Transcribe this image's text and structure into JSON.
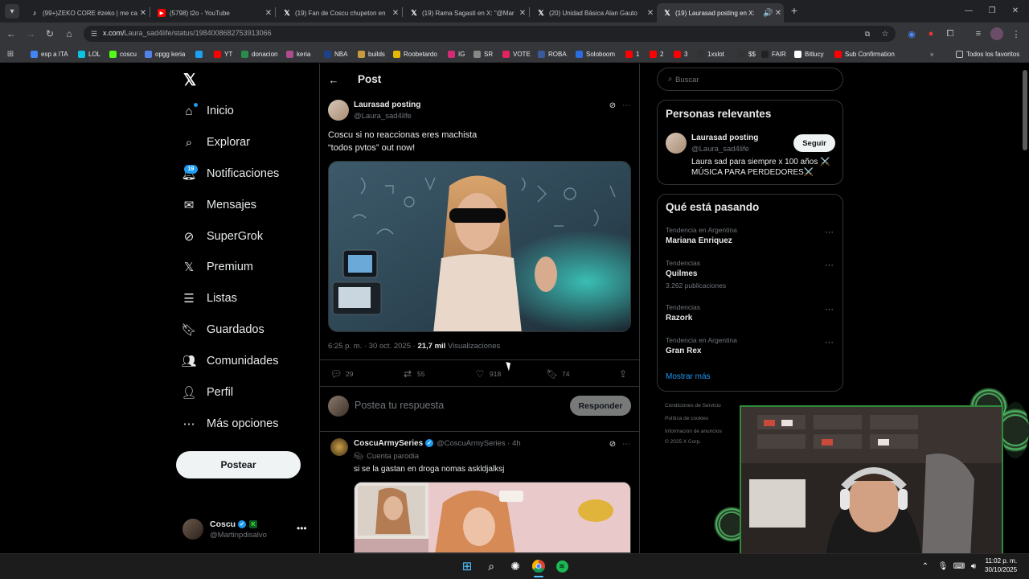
{
  "browser": {
    "tabs": [
      {
        "title": "(99+)ZEKO CORE #zeko | me ca",
        "favicon": "tiktok-icon",
        "active": false
      },
      {
        "title": "(5798) t2o - YouTube",
        "favicon": "youtube-icon",
        "active": false
      },
      {
        "title": "(19) Fan de Coscu chupeton en",
        "favicon": "x-icon",
        "active": false
      },
      {
        "title": "(19) Rama Sagasti en X: \"@Mar",
        "favicon": "x-icon",
        "active": false
      },
      {
        "title": "(20) Unidad Básica Alan Gauto",
        "favicon": "x-icon",
        "active": false
      },
      {
        "title": "(19) Laurasad posting en X:",
        "favicon": "x-icon",
        "active": true
      }
    ],
    "url_host": "x.com/",
    "url_path": "Laura_sad4life/status/1984008682753913066",
    "bookmarks": [
      {
        "label": "esp a ITA",
        "color": "#4285f4"
      },
      {
        "label": "LOL",
        "color": "#0bc4e2"
      },
      {
        "label": "coscu",
        "color": "#53fc18"
      },
      {
        "label": "opgg keria",
        "color": "#5383e8"
      },
      {
        "label": "",
        "color": "#1da1f2"
      },
      {
        "label": "YT",
        "color": "#ff0000"
      },
      {
        "label": "donacion",
        "color": "#2a8c4a"
      },
      {
        "label": "keria",
        "color": "#b04a8f"
      },
      {
        "label": "NBA",
        "color": "#1d428a"
      },
      {
        "label": "builds",
        "color": "#c89b3c"
      },
      {
        "label": "Roobetardo",
        "color": "#e6b800"
      },
      {
        "label": "IG",
        "color": "#d62976"
      },
      {
        "label": "SR",
        "color": "#888888"
      },
      {
        "label": "VOTE",
        "color": "#e0245e"
      },
      {
        "label": "ROBA",
        "color": "#3b5998"
      },
      {
        "label": "Soloboom",
        "color": "#2b6de0"
      },
      {
        "label": "1",
        "color": "#ff0000"
      },
      {
        "label": "2",
        "color": "#ff0000"
      },
      {
        "label": "3",
        "color": "#ff0000"
      },
      {
        "label": "1xslot",
        "color": "#333333"
      },
      {
        "label": "$$",
        "color": "#333333"
      },
      {
        "label": "FAIR",
        "color": "#222222"
      },
      {
        "label": "Bitlucy",
        "color": "#ffffff"
      },
      {
        "label": "Sub Confirmation",
        "color": "#ff0000"
      }
    ],
    "all_favorites": "Todos los favoritos"
  },
  "nav": {
    "items": [
      {
        "label": "Inicio",
        "icon": "home-icon"
      },
      {
        "label": "Explorar",
        "icon": "search-icon"
      },
      {
        "label": "Notificaciones",
        "icon": "bell-icon"
      },
      {
        "label": "Mensajes",
        "icon": "mail-icon"
      },
      {
        "label": "SuperGrok",
        "icon": "grok-icon"
      },
      {
        "label": "Premium",
        "icon": "x-logo-icon"
      },
      {
        "label": "Listas",
        "icon": "list-icon"
      },
      {
        "label": "Guardados",
        "icon": "bookmark-icon"
      },
      {
        "label": "Comunidades",
        "icon": "communities-icon"
      },
      {
        "label": "Perfil",
        "icon": "person-icon"
      },
      {
        "label": "Más opciones",
        "icon": "more-circle-icon"
      }
    ],
    "notifications_badge": "19",
    "post_button": "Postear",
    "account": {
      "name": "Coscu",
      "handle": "@Martinpdisalvo"
    }
  },
  "post": {
    "header_title": "Post",
    "author_name": "Laurasad posting",
    "author_handle": "@Laura_sad4life",
    "text_line1": "Coscu si no reaccionas eres machista",
    "text_line2": "“todos pvtos” out now!",
    "time": "6:25 p. m. · 30 oct. 2025 ·",
    "views_count": "21,7 mil",
    "views_label": "Visualizaciones",
    "replies": "29",
    "reposts": "55",
    "likes": "918",
    "bookmarks": "74",
    "reply_placeholder": "Postea tu respuesta",
    "reply_button": "Responder"
  },
  "reply_tweet": {
    "author_name": "CoscuArmySeries",
    "author_handle": "@CoscuArmySeries · 4h",
    "label": "Cuenta parodia",
    "text": "si se la gastan en droga nomas askldjalksj"
  },
  "sidebar": {
    "search_placeholder": "Buscar",
    "relevant_title": "Personas relevantes",
    "relevant": {
      "name": "Laurasad posting",
      "handle": "@Laura_sad4life",
      "follow": "Seguir",
      "bio_line1": "Laura sad para siempre x 100 años ⚔️",
      "bio_line2": "MÚSICA PARA PERDEDORES⚔️"
    },
    "trends_title": "Qué está pasando",
    "trends": [
      {
        "context": "Tendencia en Argentina",
        "name": "Mariana Enriquez",
        "count": ""
      },
      {
        "context": "Tendencias",
        "name": "Quilmes",
        "count": "3.262 publicaciones"
      },
      {
        "context": "Tendencias",
        "name": "Razork",
        "count": ""
      },
      {
        "context": "Tendencia en Argentina",
        "name": "Gran Rex",
        "count": ""
      }
    ],
    "show_more": "Mostrar más",
    "footer_line1": "Condiciones de Servicio",
    "footer_line2": "Política de cookies",
    "footer_line3": "Información de anuncios",
    "footer_line4": "© 2025 X Corp."
  },
  "taskbar": {
    "time": "11:02 p. m.",
    "date": "30/10/2025"
  },
  "colors": {
    "accent": "#1d9bf0",
    "background": "#000000",
    "border": "#2f3336",
    "muted_text": "#71767b",
    "webcam_frame": "#2e8b3b"
  }
}
